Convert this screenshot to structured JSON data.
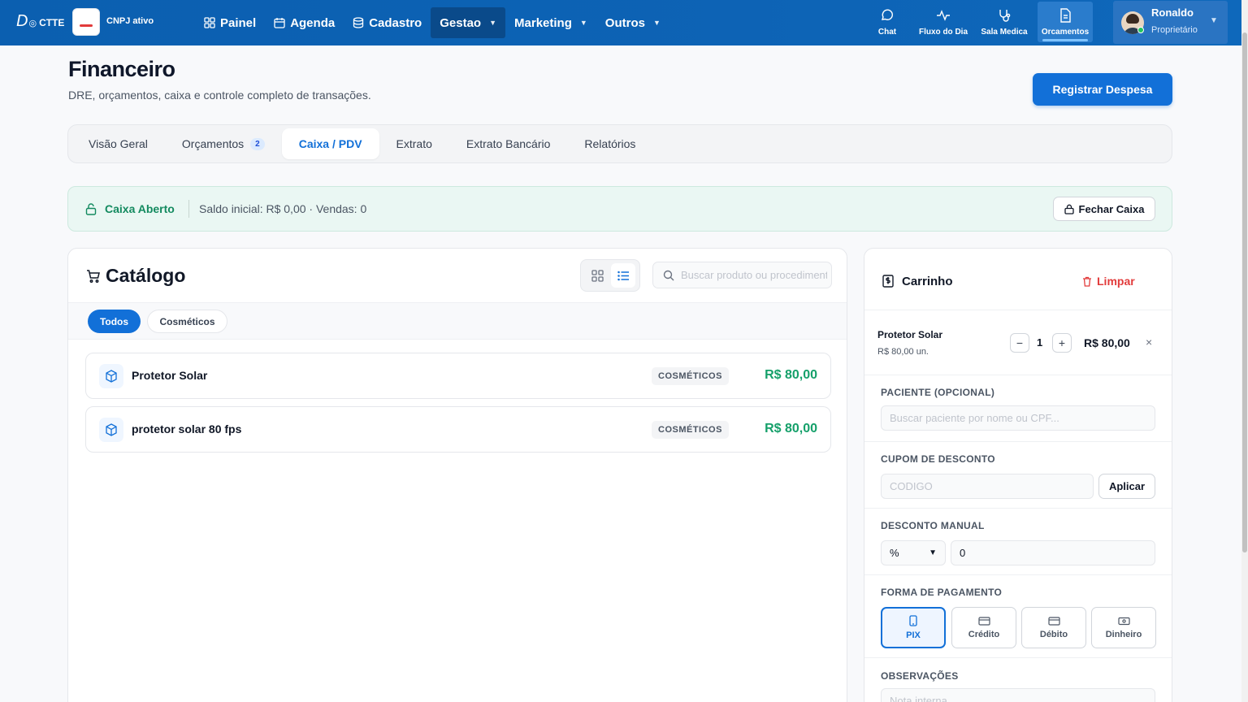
{
  "topbar": {
    "logo_main": "D",
    "logo_suffix": "CTTE",
    "cnpj_label": "CNPJ ativo",
    "nav": [
      {
        "label": "Painel",
        "icon": "grid-icon"
      },
      {
        "label": "Agenda",
        "icon": "calendar-icon"
      },
      {
        "label": "Cadastro",
        "icon": "database-icon"
      },
      {
        "label": "Gestao",
        "icon": "chevron-down-icon"
      },
      {
        "label": "Marketing",
        "icon": "chevron-down-icon"
      },
      {
        "label": "Outros",
        "icon": "chevron-down-icon"
      }
    ],
    "quick": [
      {
        "label": "Chat",
        "icon": "chat-icon"
      },
      {
        "label": "Fluxo do Dia",
        "icon": "activity-icon"
      },
      {
        "label": "Sala Medica",
        "icon": "stethoscope-icon"
      },
      {
        "label": "Orcamentos",
        "icon": "document-icon"
      }
    ],
    "user": {
      "name": "Ronaldo",
      "role": "Proprietário"
    }
  },
  "header": {
    "title": "Financeiro",
    "subtitle": "DRE, orçamentos, caixa e controle completo de transações.",
    "primary_action": "Registrar Despesa"
  },
  "tabs": [
    {
      "label": "Visão Geral"
    },
    {
      "label": "Orçamentos",
      "badge": "2"
    },
    {
      "label": "Caixa / PDV"
    },
    {
      "label": "Extrato"
    },
    {
      "label": "Extrato Bancário"
    },
    {
      "label": "Relatórios"
    }
  ],
  "caixa": {
    "status": "Caixa Aberto",
    "info": "Saldo inicial: R$ 0,00 · Vendas: 0",
    "close_label": "Fechar Caixa"
  },
  "catalog": {
    "title": "Catálogo",
    "search_placeholder": "Buscar produto ou procedimento",
    "filters": [
      "Todos",
      "Cosméticos"
    ],
    "products": [
      {
        "name": "Protetor Solar",
        "category": "COSMÉTICOS",
        "price": "R$ 80,00"
      },
      {
        "name": "protetor solar 80 fps",
        "category": "COSMÉTICOS",
        "price": "R$ 80,00"
      }
    ]
  },
  "cart": {
    "title": "Carrinho",
    "clear_label": "Limpar",
    "item": {
      "name": "Protetor Solar",
      "unit": "R$ 80,00 un.",
      "qty": "1",
      "total": "R$ 80,00",
      "remove": "×",
      "minus": "−",
      "plus": "+"
    },
    "patient_label": "PACIENTE (OPCIONAL)",
    "patient_placeholder": "Buscar paciente por nome ou CPF...",
    "coupon_label": "CUPOM DE DESCONTO",
    "coupon_placeholder": "CODIGO",
    "apply_label": "Aplicar",
    "discount_label": "DESCONTO MANUAL",
    "discount_type": "%",
    "discount_value": "0",
    "payment_label": "FORMA DE PAGAMENTO",
    "payments": [
      "PIX",
      "Crédito",
      "Débito",
      "Dinheiro"
    ],
    "notes_label": "OBSERVAÇÕES",
    "notes_placeholder": "Nota interna..."
  },
  "colors": {
    "primary": "#1270d8",
    "success": "#15a06a",
    "danger": "#e23b3b",
    "nav": "#0d63b5"
  }
}
